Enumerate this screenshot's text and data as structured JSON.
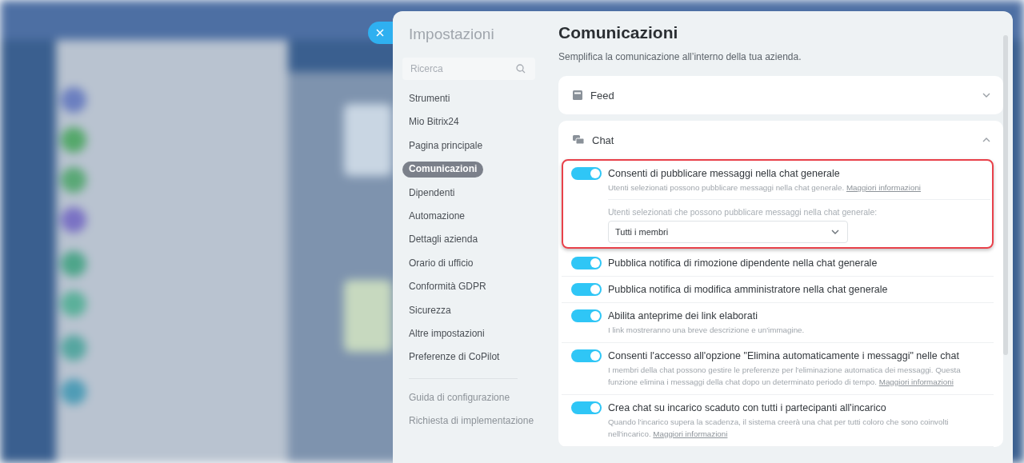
{
  "sidebar": {
    "title": "Impostazioni",
    "search": {
      "placeholder": "Ricerca"
    },
    "items": [
      {
        "label": "Strumenti",
        "selected": false
      },
      {
        "label": "Mio Bitrix24",
        "selected": false
      },
      {
        "label": "Pagina principale",
        "selected": false
      },
      {
        "label": "Comunicazioni",
        "selected": true
      },
      {
        "label": "Dipendenti",
        "selected": false
      },
      {
        "label": "Automazione",
        "selected": false
      },
      {
        "label": "Dettagli azienda",
        "selected": false
      },
      {
        "label": "Orario di ufficio",
        "selected": false
      },
      {
        "label": "Conformità GDPR",
        "selected": false
      },
      {
        "label": "Sicurezza",
        "selected": false
      },
      {
        "label": "Altre impostazioni",
        "selected": false
      },
      {
        "label": "Preferenze di CoPilot",
        "selected": false
      }
    ],
    "footer_links": [
      "Guida di configurazione",
      "Richiesta di implementazione"
    ]
  },
  "page": {
    "title": "Comunicazioni",
    "subtitle": "Semplifica la comunicazione all’interno della tua azienda.",
    "sections": [
      {
        "kind": "feed",
        "title": "Feed",
        "expanded": false
      },
      {
        "kind": "chat",
        "title": "Chat",
        "expanded": true,
        "settings": [
          {
            "title": "Consenti di pubblicare messaggi nella chat generale",
            "on": true,
            "highlighted": true,
            "description": "Utenti selezionati possono pubblicare messaggi nella chat generale.",
            "link": "Maggiori informazioni",
            "select": {
              "label": "Utenti selezionati che possono pubblicare messaggi nella chat generale:",
              "value": "Tutti i membri"
            }
          },
          {
            "title": "Pubblica notifica di rimozione dipendente nella chat generale",
            "on": true,
            "highlighted": false
          },
          {
            "title": "Pubblica notifica di modifica amministratore nella chat generale",
            "on": true,
            "highlighted": false
          },
          {
            "title": "Abilita anteprime dei link elaborati",
            "on": true,
            "highlighted": false,
            "description": "I link mostreranno una breve descrizione e un'immagine."
          },
          {
            "title": "Consenti l'accesso all'opzione \"Elimina automaticamente i messaggi\" nelle chat",
            "on": true,
            "highlighted": false,
            "description": "I membri della chat possono gestire le preferenze per l'eliminazione automatica dei messaggi. Questa funzione elimina i messaggi della chat dopo un determinato periodo di tempo.",
            "link": "Maggiori informazioni"
          },
          {
            "title": "Crea chat su incarico scaduto con tutti i partecipanti all'incarico",
            "on": true,
            "highlighted": false,
            "description": "Quando l'incarico supera la scadenza, il sistema creerà una chat per tutti coloro che sono coinvolti nell'incarico.",
            "link": "Maggiori informazioni"
          }
        ]
      }
    ]
  }
}
